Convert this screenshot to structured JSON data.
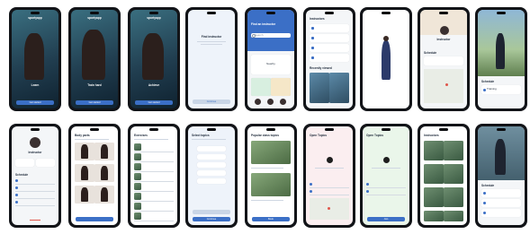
{
  "screens": {
    "s1": {
      "brand": "sportyapp",
      "title": "Learn",
      "button": "Get started"
    },
    "s2": {
      "brand": "sportyapp",
      "title": "Train hard",
      "button": "Get started"
    },
    "s3": {
      "brand": "sportyapp",
      "title": "Achieve",
      "button": "Get started"
    },
    "s4": {
      "title": "Find instructor",
      "button": "Continue"
    },
    "s5": {
      "title": "Find an instructor",
      "search": "Search",
      "section": "Instructors",
      "nearby": "Nearby"
    },
    "s6": {
      "title": "Instructors",
      "section": "Recently viewed"
    },
    "s7": {
      "label": ""
    },
    "s8": {
      "name": "Instructor",
      "section": "Schedule"
    },
    "s9": {
      "section": "Schedule",
      "item": "Training"
    },
    "s10": {
      "name": "Instructor",
      "section": "Schedule"
    },
    "s11": {
      "title": "Body parts"
    },
    "s12": {
      "title": "Exercises"
    },
    "s13": {
      "title": "Select topics",
      "button": "Continue"
    },
    "s14": {
      "title": "Popular class topics",
      "button": "Book"
    },
    "s15": {
      "title": "Open Topics",
      "button": "Join"
    },
    "s16": {
      "title": "Open Topics",
      "button": "Join"
    },
    "s17": {
      "title": "Instructors"
    },
    "s18": {
      "section": "Schedule"
    }
  },
  "colors": {
    "accent": "#3b6fc6",
    "frame": "#121418",
    "photo": "#2a4f60"
  }
}
